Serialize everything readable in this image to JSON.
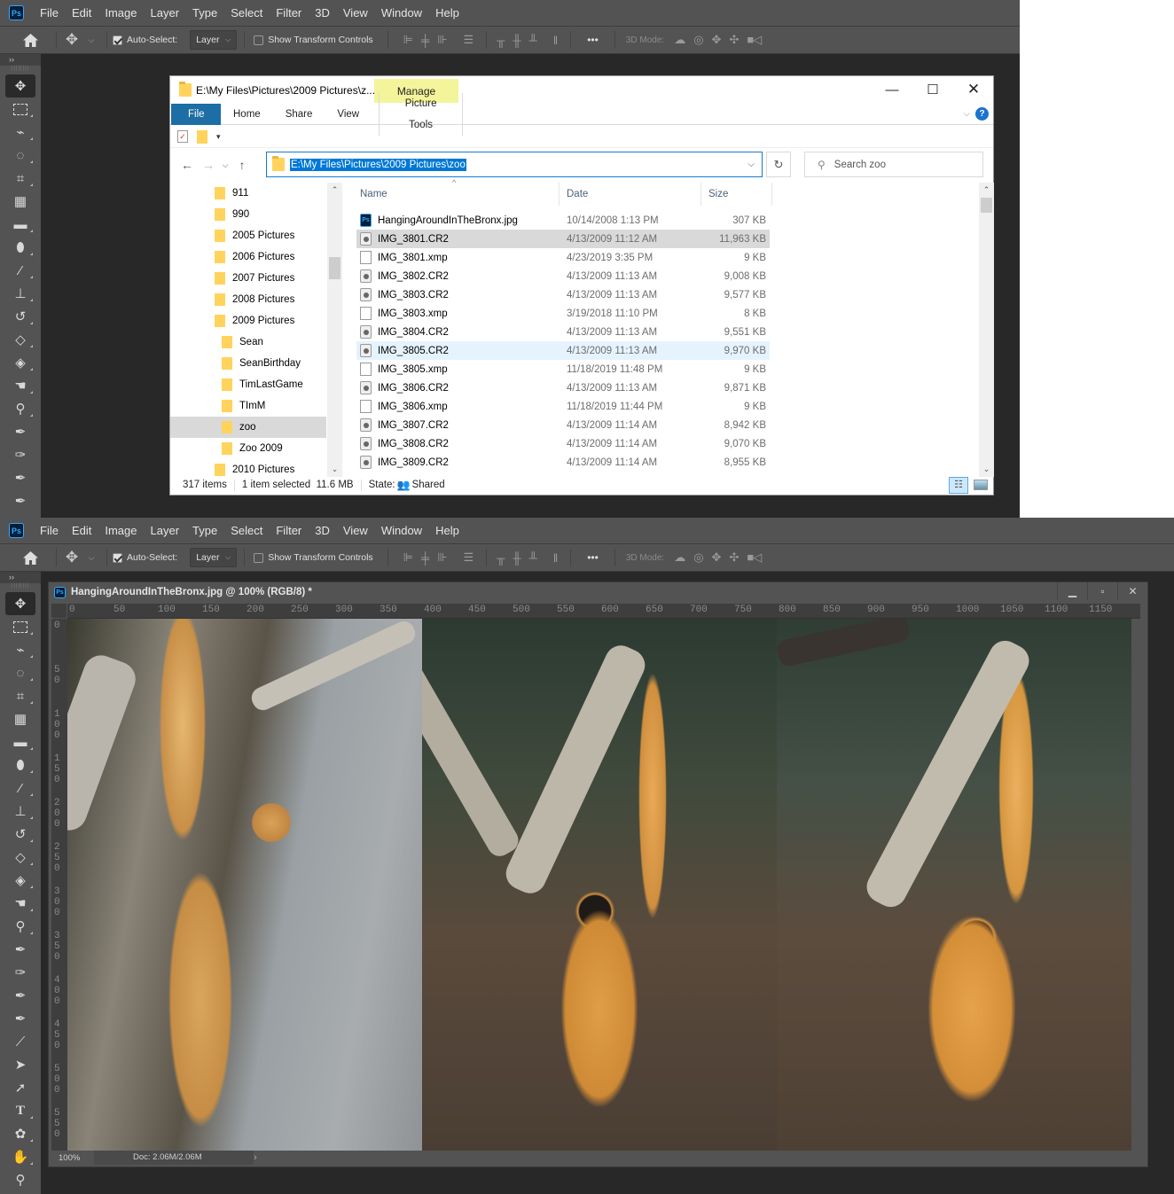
{
  "photoshop": {
    "menu": [
      "File",
      "Edit",
      "Image",
      "Layer",
      "Type",
      "Select",
      "Filter",
      "3D",
      "View",
      "Window",
      "Help"
    ],
    "logo": "Ps",
    "options": {
      "auto_select_label": "Auto-Select:",
      "auto_select_checked": true,
      "layer_select": "Layer",
      "show_transform_label": "Show Transform Controls",
      "show_transform_checked": false,
      "more": "•••",
      "mode_3d_label": "3D Mode:"
    },
    "tools": [
      "move",
      "rectangular-marquee",
      "polygonal-lasso",
      "quick-selection",
      "crop",
      "perspective-crop",
      "ruler",
      "healing-brush",
      "brush",
      "clone-stamp",
      "history-brush",
      "eraser",
      "paint-bucket",
      "smudge",
      "dodge",
      "pen",
      "freeform-pen",
      "add-anchor-point",
      "delete-anchor-point",
      "convert-point",
      "path-selection",
      "direct-selection",
      "type",
      "custom-shape",
      "hand-rotate",
      "zoom"
    ],
    "document": {
      "title": "HangingAroundInTheBronx.jpg @ 100% (RGB/8) *",
      "zoom": "100%",
      "doc_size": "Doc: 2.06M/2.06M",
      "ruler_h": [
        "0",
        "50",
        "100",
        "150",
        "200",
        "250",
        "300",
        "350",
        "400",
        "450",
        "500",
        "550",
        "600",
        "650",
        "700",
        "750",
        "800",
        "850",
        "900",
        "950",
        "1000",
        "1050",
        "1100",
        "1150"
      ],
      "ruler_v": [
        "0",
        "50",
        "100",
        "150",
        "200",
        "250",
        "300",
        "350",
        "400",
        "450",
        "500",
        "550"
      ]
    }
  },
  "explorer": {
    "title": "E:\\My Files\\Pictures\\2009 Pictures\\z...",
    "manage_tab": "Manage",
    "ribbon_tabs": [
      "File",
      "Home",
      "Share",
      "View"
    ],
    "picture_tools_tab": "Picture Tools",
    "address": "E:\\My Files\\Pictures\\2009 Pictures\\zoo",
    "search_placeholder": "Search zoo",
    "tree": [
      {
        "label": "911",
        "level": 0
      },
      {
        "label": "990",
        "level": 0
      },
      {
        "label": "2005 Pictures",
        "level": 0
      },
      {
        "label": "2006 Pictures",
        "level": 0
      },
      {
        "label": "2007 Pictures",
        "level": 0
      },
      {
        "label": "2008 Pictures",
        "level": 0
      },
      {
        "label": "2009 Pictures",
        "level": 0
      },
      {
        "label": "Sean",
        "level": 1
      },
      {
        "label": "SeanBirthday",
        "level": 1
      },
      {
        "label": "TimLastGame",
        "level": 1
      },
      {
        "label": "TImM",
        "level": 1
      },
      {
        "label": "zoo",
        "level": 1,
        "selected": true
      },
      {
        "label": "Zoo 2009",
        "level": 1
      },
      {
        "label": "2010 Pictures",
        "level": 0
      }
    ],
    "columns": {
      "name": "Name",
      "date": "Date",
      "size": "Size"
    },
    "files": [
      {
        "name": "HangingAroundInTheBronx.jpg",
        "date": "10/14/2008 1:13 PM",
        "size": "307 KB",
        "type": "psd"
      },
      {
        "name": "IMG_3801.CR2",
        "date": "4/13/2009 11:12 AM",
        "size": "11,963 KB",
        "type": "cr2",
        "state": "selected"
      },
      {
        "name": "IMG_3801.xmp",
        "date": "4/23/2019 3:35 PM",
        "size": "9 KB",
        "type": "xmp"
      },
      {
        "name": "IMG_3802.CR2",
        "date": "4/13/2009 11:13 AM",
        "size": "9,008 KB",
        "type": "cr2"
      },
      {
        "name": "IMG_3803.CR2",
        "date": "4/13/2009 11:13 AM",
        "size": "9,577 KB",
        "type": "cr2"
      },
      {
        "name": "IMG_3803.xmp",
        "date": "3/19/2018 11:10 PM",
        "size": "8 KB",
        "type": "xmp"
      },
      {
        "name": "IMG_3804.CR2",
        "date": "4/13/2009 11:13 AM",
        "size": "9,551 KB",
        "type": "cr2"
      },
      {
        "name": "IMG_3805.CR2",
        "date": "4/13/2009 11:13 AM",
        "size": "9,970 KB",
        "type": "cr2",
        "state": "hover"
      },
      {
        "name": "IMG_3805.xmp",
        "date": "11/18/2019 11:48 PM",
        "size": "9 KB",
        "type": "xmp"
      },
      {
        "name": "IMG_3806.CR2",
        "date": "4/13/2009 11:13 AM",
        "size": "9,871 KB",
        "type": "cr2"
      },
      {
        "name": "IMG_3806.xmp",
        "date": "11/18/2019 11:44 PM",
        "size": "9 KB",
        "type": "xmp"
      },
      {
        "name": "IMG_3807.CR2",
        "date": "4/13/2009 11:14 AM",
        "size": "8,942 KB",
        "type": "cr2"
      },
      {
        "name": "IMG_3808.CR2",
        "date": "4/13/2009 11:14 AM",
        "size": "9,070 KB",
        "type": "cr2"
      },
      {
        "name": "IMG_3809.CR2",
        "date": "4/13/2009 11:14 AM",
        "size": "8,955 KB",
        "type": "cr2"
      }
    ],
    "status": {
      "items": "317 items",
      "selected": "1 item selected  11.6 MB",
      "state_label": "State:",
      "state_value": "Shared"
    }
  }
}
